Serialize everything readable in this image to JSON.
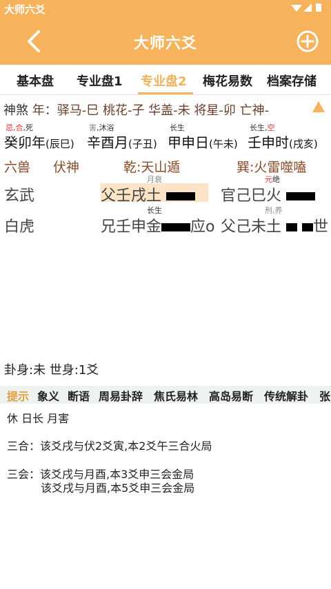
{
  "statusbar": {
    "title": "大师六爻",
    "icons": "▼◢ ▮"
  },
  "appbar": {
    "title": "大师六爻"
  },
  "tabs": [
    {
      "label": "基本盘"
    },
    {
      "label": "专业盘1"
    },
    {
      "label": "专业盘2"
    },
    {
      "label": "梅花易数"
    },
    {
      "label": "档案存储"
    }
  ],
  "shensha": {
    "label": "神煞",
    "text": "年：驿马-巳 桃花-子 华盖-未 将星-卯 亡神-"
  },
  "pillars": {
    "year": {
      "marks_red": "忌,合",
      "marks": ",死",
      "main": "癸卯年",
      "sub": "(辰巳)"
    },
    "month": {
      "marks_grey": "害",
      "marks": ",沐浴",
      "main": "辛酉月",
      "sub": "(子丑)"
    },
    "day": {
      "marks": "长生",
      "main": "甲申日",
      "sub": "(午未)"
    },
    "hour": {
      "marks": "长生,",
      "marks_red": "空",
      "main": "壬申时",
      "sub": "(戌亥)"
    }
  },
  "gua": {
    "liushou": "六兽",
    "fushen": "伏神",
    "main": "乾:天山遁",
    "changed": "巽:火雷噬嗑"
  },
  "lines": [
    {
      "beast": "玄武",
      "main_mark": "月衰",
      "main": "父壬戌土",
      "changed_mark_red": "元",
      "changed_mark": "绝",
      "changed": "官己巳火",
      "shiying": ""
    },
    {
      "beast": "白虎",
      "main_mark": "长生",
      "main": "兄壬申金",
      "main_tail": "应o",
      "changed_mark": "刑,养",
      "changed": "父己未土",
      "shiying": "世"
    }
  ],
  "guashen": "卦身:未 世身:1爻",
  "subtabs": [
    {
      "label": "提示"
    },
    {
      "label": "象义"
    },
    {
      "label": "断语"
    },
    {
      "label": "周易卦辞"
    },
    {
      "label": "焦氏易林"
    },
    {
      "label": "高岛易断"
    },
    {
      "label": "传统解卦"
    },
    {
      "label": "张"
    }
  ],
  "details": {
    "state": "休 日长 月害",
    "sanhe": "三合：该爻戌与伏2爻寅,本2爻午三合火局",
    "sanhui_1": "三会：该爻戌与月酉,本3爻申三会金局",
    "sanhui_2": "该爻戌与月酉,本5爻申三会金局"
  },
  "colors": {
    "accent": "#f6b35c",
    "active_tab": "#f0b35c",
    "red": "#e03333",
    "brown": "#8a4a2a"
  }
}
